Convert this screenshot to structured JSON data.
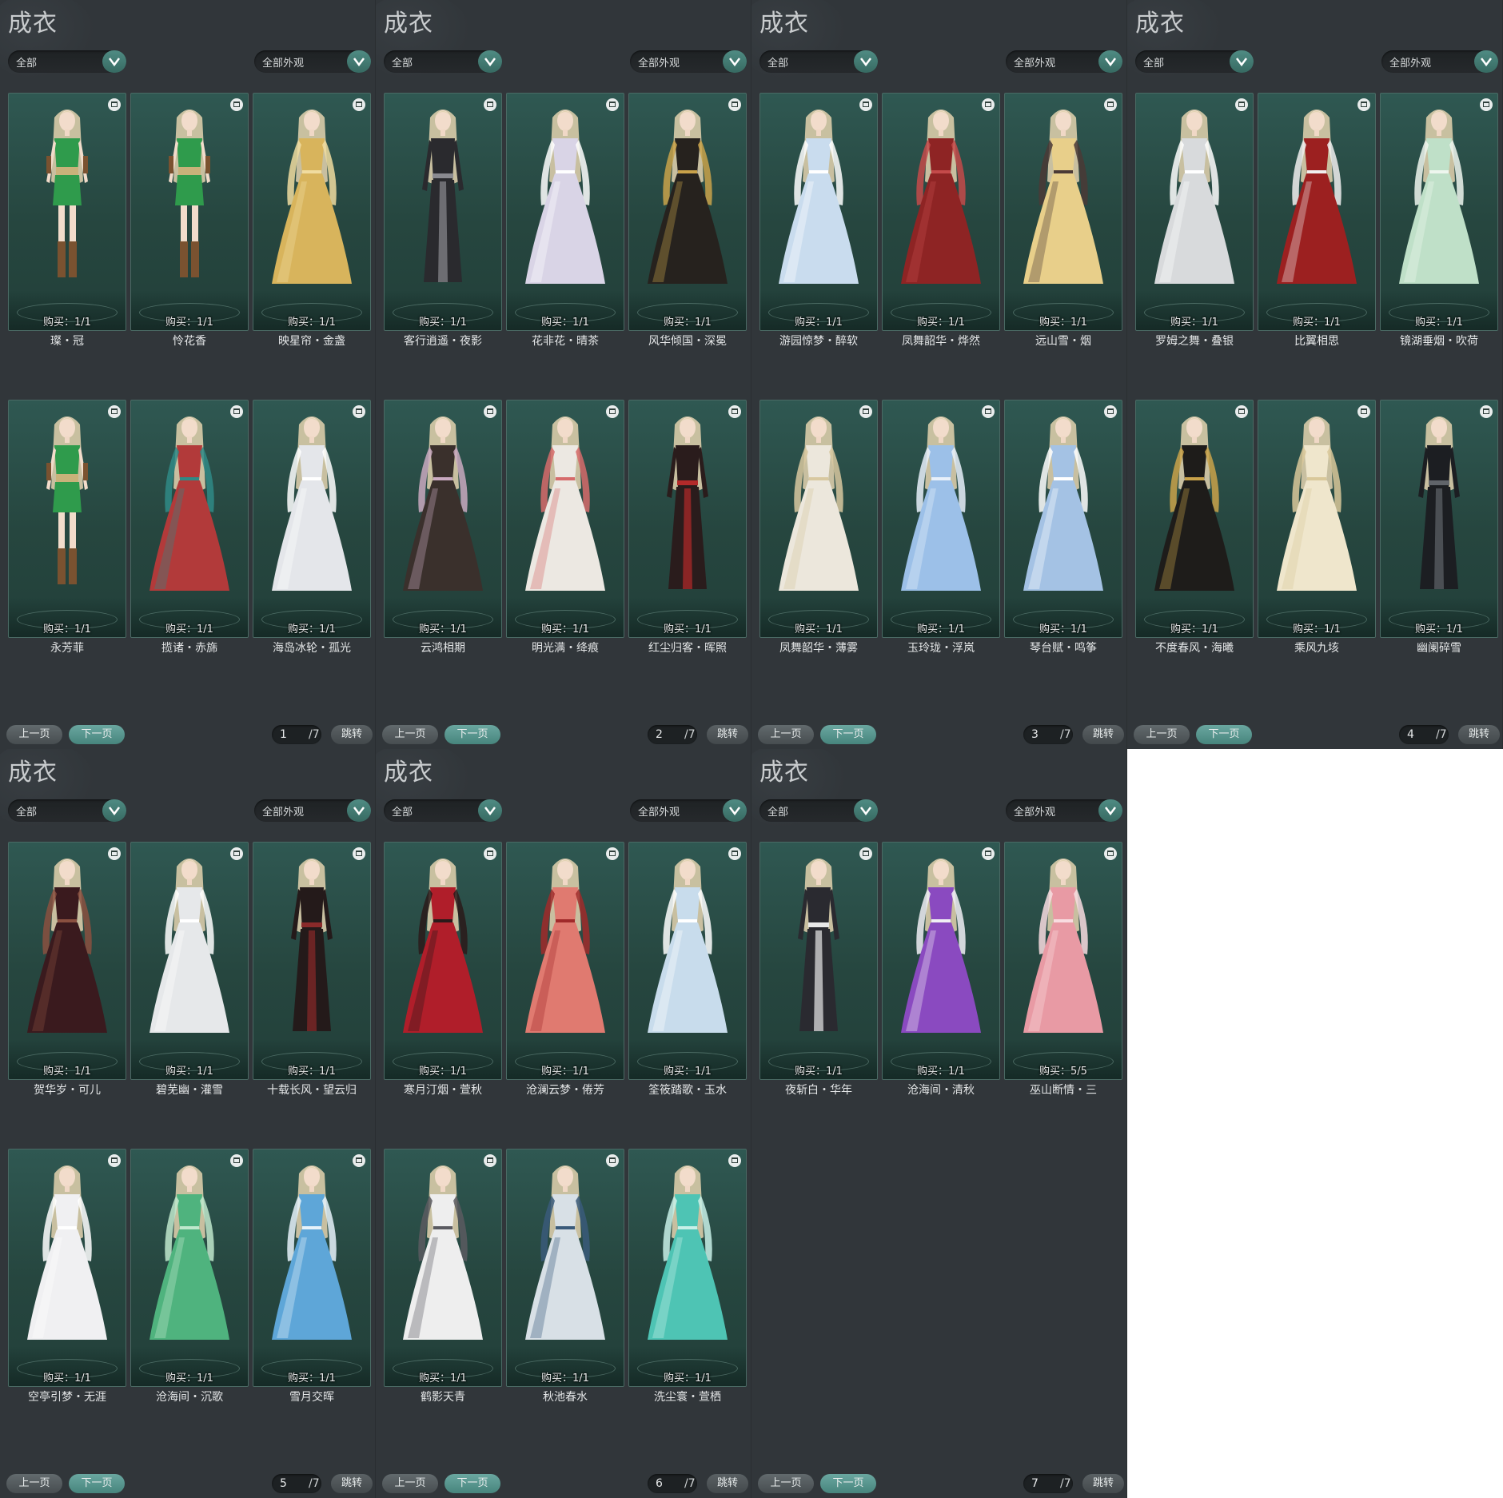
{
  "screen_title": "成衣",
  "filter_left": "全部",
  "filter_right": "全部外观",
  "prev_label": "上一页",
  "next_label": "下一页",
  "jump_label": "跳转",
  "total_pages": "/7",
  "buy_prefix": "购买：",
  "pages": [
    {
      "page": "1",
      "items": [
        {
          "name": "璨・冠",
          "buy": "1/1",
          "dress": "#2f9b4c",
          "accent": "#7a5230",
          "style": "short"
        },
        {
          "name": "怜花香",
          "buy": "1/1",
          "dress": "#2f9b4c",
          "accent": "#7a5230",
          "style": "short"
        },
        {
          "name": "映星帘・金盏",
          "buy": "1/1",
          "dress": "#d8b45c",
          "accent": "#f0dca0",
          "style": "gown"
        },
        {
          "name": "永芳菲",
          "buy": "1/1",
          "dress": "#2f9b4c",
          "accent": "#7a5230",
          "style": "short"
        },
        {
          "name": "揽诸・赤旆",
          "buy": "1/1",
          "dress": "#b23a3a",
          "accent": "#2f8a86",
          "style": "gown"
        },
        {
          "name": "海岛冰轮・孤光",
          "buy": "1/1",
          "dress": "#e4e6ea",
          "accent": "#ffffff",
          "style": "gown"
        }
      ]
    },
    {
      "page": "2",
      "items": [
        {
          "name": "客行逍遥・夜影",
          "buy": "1/1",
          "dress": "#2a2a2e",
          "accent": "#8a8a90",
          "style": "slim"
        },
        {
          "name": "花非花・晴茶",
          "buy": "1/1",
          "dress": "#d9d4e6",
          "accent": "#ffffff",
          "style": "gown"
        },
        {
          "name": "风华倾国・深冕",
          "buy": "1/1",
          "dress": "#26221e",
          "accent": "#c9a24a",
          "style": "gown"
        },
        {
          "name": "云鸿相期",
          "buy": "1/1",
          "dress": "#3a302c",
          "accent": "#c9a9c0",
          "style": "gown"
        },
        {
          "name": "明光满・绛痕",
          "buy": "1/1",
          "dress": "#ece8e2",
          "accent": "#d66b6b",
          "style": "gown"
        },
        {
          "name": "红尘归客・晖照",
          "buy": "1/1",
          "dress": "#2a1c1c",
          "accent": "#b32a2a",
          "style": "slim"
        }
      ]
    },
    {
      "page": "3",
      "items": [
        {
          "name": "游园惊梦・醉软",
          "buy": "1/1",
          "dress": "#c9dcee",
          "accent": "#ffffff",
          "style": "gown"
        },
        {
          "name": "凤舞韶华・烨然",
          "buy": "1/1",
          "dress": "#8e2424",
          "accent": "#c44a4a",
          "style": "gown"
        },
        {
          "name": "远山雪・烟",
          "buy": "1/1",
          "dress": "#e8cf8a",
          "accent": "#4a3a36",
          "style": "gown"
        },
        {
          "name": "凤舞韶华・薄雾",
          "buy": "1/1",
          "dress": "#ece7dc",
          "accent": "#d8c8a0",
          "style": "gown"
        },
        {
          "name": "玉玲珑・浮岚",
          "buy": "1/1",
          "dress": "#9cc0e8",
          "accent": "#e8f0fa",
          "style": "gown"
        },
        {
          "name": "琴台赋・鸣筝",
          "buy": "1/1",
          "dress": "#a4c2e4",
          "accent": "#ffffff",
          "style": "gown"
        }
      ]
    },
    {
      "page": "4",
      "items": [
        {
          "name": "罗姆之舞・叠银",
          "buy": "1/1",
          "dress": "#d8dadc",
          "accent": "#ffffff",
          "style": "gown"
        },
        {
          "name": "比翼相思",
          "buy": "1/1",
          "dress": "#9c2020",
          "accent": "#f0eeee",
          "style": "gown"
        },
        {
          "name": "镜湖垂烟・吹荷",
          "buy": "1/1",
          "dress": "#bfe0c8",
          "accent": "#eef6ee",
          "style": "gown"
        },
        {
          "name": "不度春风・海曦",
          "buy": "1/1",
          "dress": "#1e1c1a",
          "accent": "#c9a24a",
          "style": "gown"
        },
        {
          "name": "乘风九垓",
          "buy": "1/1",
          "dress": "#efe6cc",
          "accent": "#d9c89a",
          "style": "gown"
        },
        {
          "name": "幽阑碎雪",
          "buy": "1/1",
          "dress": "#1c1e22",
          "accent": "#60646a",
          "style": "slim"
        }
      ]
    },
    {
      "page": "5",
      "items": [
        {
          "name": "贺华岁・可儿",
          "buy": "1/1",
          "dress": "#3a1a1e",
          "accent": "#8a5040",
          "style": "gown"
        },
        {
          "name": "碧芜幽・灌雪",
          "buy": "1/1",
          "dress": "#e6e8ea",
          "accent": "#ffffff",
          "style": "gown"
        },
        {
          "name": "十载长风・望云归",
          "buy": "1/1",
          "dress": "#241a1a",
          "accent": "#8a2a2a",
          "style": "slim"
        },
        {
          "name": "空亭引梦・无涯",
          "buy": "1/1",
          "dress": "#f0f0f2",
          "accent": "#ffffff",
          "style": "gown"
        },
        {
          "name": "沧海间・沉歌",
          "buy": "1/1",
          "dress": "#4fb37e",
          "accent": "#bfe8cc",
          "style": "gown"
        },
        {
          "name": "雪月交晖",
          "buy": "1/1",
          "dress": "#5ea6d8",
          "accent": "#e6f2fa",
          "style": "gown"
        }
      ]
    },
    {
      "page": "6",
      "items": [
        {
          "name": "寒月汀烟・萱秋",
          "buy": "1/1",
          "dress": "#b01e2a",
          "accent": "#2a1a1a",
          "style": "gown"
        },
        {
          "name": "沧澜云梦・倦芳",
          "buy": "1/1",
          "dress": "#e07a70",
          "accent": "#a02a2a",
          "style": "gown"
        },
        {
          "name": "筌筱踏歌・玉水",
          "buy": "1/1",
          "dress": "#c8dcec",
          "accent": "#ffffff",
          "style": "gown"
        },
        {
          "name": "鹤影天青",
          "buy": "1/1",
          "dress": "#eeeeee",
          "accent": "#5a5a60",
          "style": "gown"
        },
        {
          "name": "秋池春水",
          "buy": "1/1",
          "dress": "#d8e0e6",
          "accent": "#3a5a7a",
          "style": "gown"
        },
        {
          "name": "洗尘寰・萱栖",
          "buy": "1/1",
          "dress": "#4ec4b4",
          "accent": "#c8f0e8",
          "style": "gown"
        }
      ]
    },
    {
      "page": "7",
      "items": [
        {
          "name": "夜斩白・华年",
          "buy": "1/1",
          "dress": "#2a2a30",
          "accent": "#e8e8e8",
          "style": "slim"
        },
        {
          "name": "沧海间・清秋",
          "buy": "1/1",
          "dress": "#8a4ac0",
          "accent": "#f0eef4",
          "style": "gown"
        },
        {
          "name": "巫山断情・三",
          "buy": "5/5",
          "dress": "#e89aa4",
          "accent": "#f8dce0",
          "style": "gown"
        }
      ]
    }
  ]
}
